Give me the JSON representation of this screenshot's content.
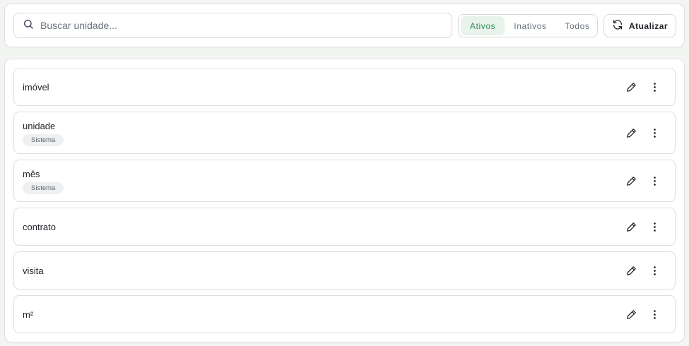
{
  "toolbar": {
    "search": {
      "placeholder": "Buscar unidade...",
      "value": ""
    },
    "filters": [
      {
        "label": "Ativos",
        "active": true
      },
      {
        "label": "Inativos",
        "active": false
      },
      {
        "label": "Todos",
        "active": false
      }
    ],
    "refresh_label": "Atualizar"
  },
  "items": [
    {
      "name": "imóvel",
      "badge": ""
    },
    {
      "name": "unidade",
      "badge": "Sistema"
    },
    {
      "name": "mês",
      "badge": "Sistema"
    },
    {
      "name": "contrato",
      "badge": ""
    },
    {
      "name": "visita",
      "badge": ""
    },
    {
      "name": "m²",
      "badge": ""
    }
  ],
  "icons": {
    "search": "search-icon",
    "refresh": "refresh-icon",
    "edit": "pencil-icon",
    "more": "more-vertical-icon"
  },
  "colors": {
    "accent": "#2f8f5b",
    "accent_bg": "#e8f3ec",
    "badge_bg": "#eef0f2"
  }
}
